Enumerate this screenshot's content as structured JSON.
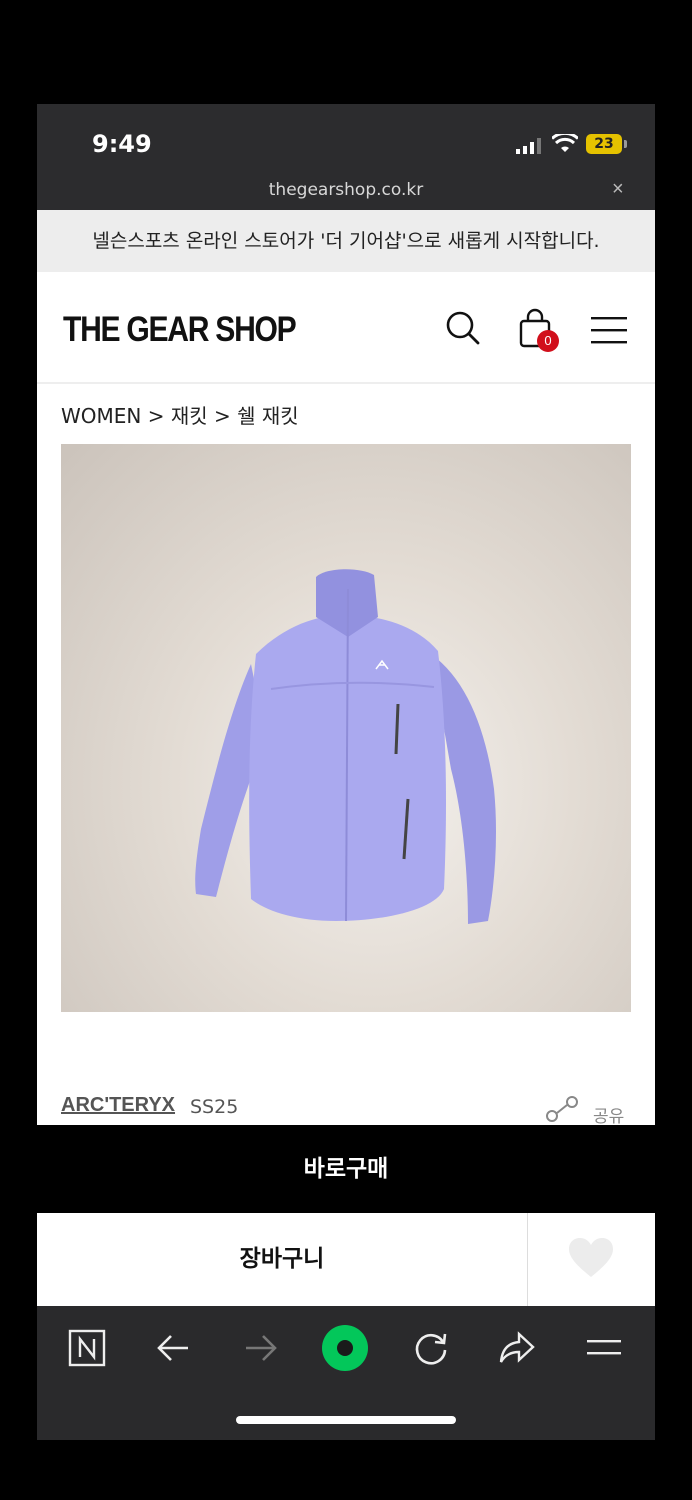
{
  "status_bar": {
    "time": "9:49",
    "battery": "23"
  },
  "browser": {
    "url": "thegearshop.co.kr",
    "close_label": "×"
  },
  "announcement": "넬슨스포츠 온라인 스토어가 '더 기어샵'으로 새롭게 시작합니다.",
  "header": {
    "logo": "THE GEAR SHOP",
    "cart_count": "0"
  },
  "breadcrumb": "WOMEN > 재킷 > 쉘 재킷",
  "product": {
    "image_icon": "jacket-image",
    "brand": "ARC'TERYX",
    "season": "SS25",
    "share_label": "공유"
  },
  "actions": {
    "buy_now": "바로구매",
    "add_to_cart": "장바구니"
  },
  "colors": {
    "jacket": "#a7a6ee",
    "badge": "#d10f1b",
    "naver_green": "#03c75a"
  },
  "toolbar_icons": [
    "naver-n-icon",
    "back-arrow-icon",
    "forward-arrow-icon",
    "green-dot-icon",
    "reload-icon",
    "share-arrow-icon",
    "menu-icon"
  ]
}
